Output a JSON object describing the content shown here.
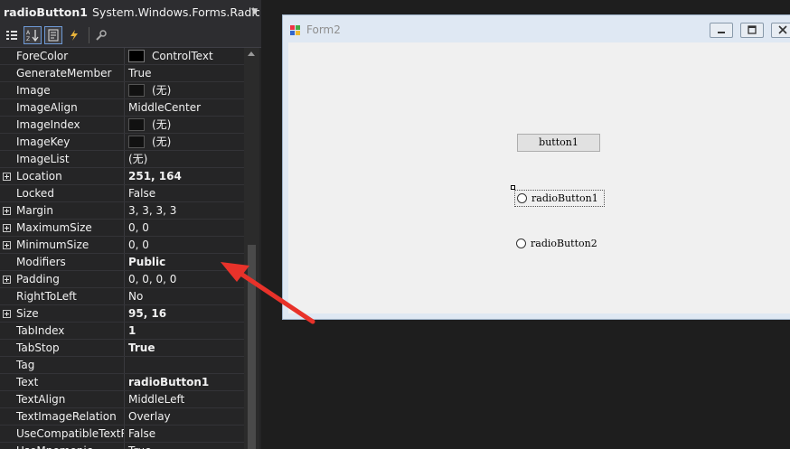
{
  "object_selector": {
    "name": "radioButton1",
    "type": "System.Windows.Forms.RadioB"
  },
  "toolbar": [
    "categorized-icon",
    "alphabetical-icon",
    "properties-icon",
    "events-icon",
    "property-pages-icon"
  ],
  "properties": [
    {
      "name": "ForeColor",
      "value": "ControlText",
      "swatch": "#000000",
      "bold": false,
      "expandable": false
    },
    {
      "name": "GenerateMember",
      "value": "True",
      "bold": false,
      "expandable": false
    },
    {
      "name": "Image",
      "value": "(无)",
      "swatch": "#111111",
      "bold": false,
      "expandable": false
    },
    {
      "name": "ImageAlign",
      "value": "MiddleCenter",
      "bold": false,
      "expandable": false
    },
    {
      "name": "ImageIndex",
      "value": "(无)",
      "swatch": "#111111",
      "bold": false,
      "expandable": false
    },
    {
      "name": "ImageKey",
      "value": "(无)",
      "swatch": "#111111",
      "bold": false,
      "expandable": false
    },
    {
      "name": "ImageList",
      "value": "(无)",
      "bold": false,
      "expandable": false
    },
    {
      "name": "Location",
      "value": "251, 164",
      "bold": true,
      "expandable": true
    },
    {
      "name": "Locked",
      "value": "False",
      "bold": false,
      "expandable": false
    },
    {
      "name": "Margin",
      "value": "3, 3, 3, 3",
      "bold": false,
      "expandable": true
    },
    {
      "name": "MaximumSize",
      "value": "0, 0",
      "bold": false,
      "expandable": true
    },
    {
      "name": "MinimumSize",
      "value": "0, 0",
      "bold": false,
      "expandable": true
    },
    {
      "name": "Modifiers",
      "value": "Public",
      "bold": true,
      "expandable": false
    },
    {
      "name": "Padding",
      "value": "0, 0, 0, 0",
      "bold": false,
      "expandable": true
    },
    {
      "name": "RightToLeft",
      "value": "No",
      "bold": false,
      "expandable": false
    },
    {
      "name": "Size",
      "value": "95, 16",
      "bold": true,
      "expandable": true
    },
    {
      "name": "TabIndex",
      "value": "1",
      "bold": true,
      "expandable": false
    },
    {
      "name": "TabStop",
      "value": "True",
      "bold": true,
      "expandable": false
    },
    {
      "name": "Tag",
      "value": "",
      "bold": false,
      "expandable": false
    },
    {
      "name": "Text",
      "value": "radioButton1",
      "bold": true,
      "expandable": false
    },
    {
      "name": "TextAlign",
      "value": "MiddleLeft",
      "bold": false,
      "expandable": false
    },
    {
      "name": "TextImageRelation",
      "value": "Overlay",
      "bold": false,
      "expandable": false
    },
    {
      "name": "UseCompatibleTextR",
      "value": "False",
      "bold": false,
      "expandable": false
    },
    {
      "name": "UseMnemonic",
      "value": "True",
      "bold": false,
      "expandable": false
    }
  ],
  "form": {
    "title": "Form2",
    "button1_label": "button1",
    "radio1_label": "radioButton1",
    "radio2_label": "radioButton2"
  },
  "colors": {
    "annotation_arrow": "#e8322a",
    "accent": "#6e9ad6"
  }
}
